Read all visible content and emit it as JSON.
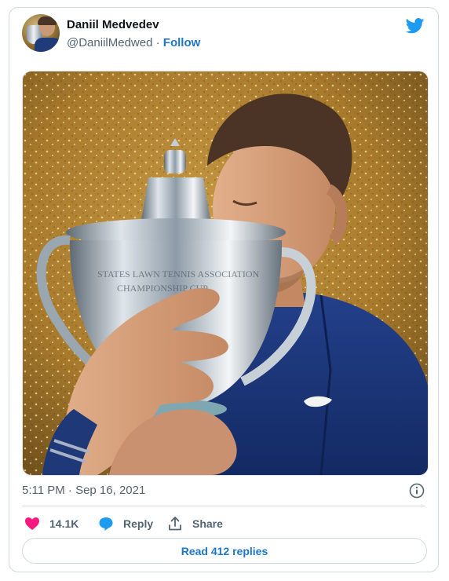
{
  "author": {
    "name": "Daniil Medvedev",
    "handle": "@DaniilMedwed",
    "separator": "·",
    "follow_label": "Follow"
  },
  "icons": {
    "brand": "twitter-bird-icon",
    "like": "heart-icon",
    "reply": "speech-bubble-icon",
    "share": "share-upload-icon",
    "info": "info-icon"
  },
  "colors": {
    "accent": "#1d9bf0",
    "link": "#1d76c9",
    "like": "#f91880",
    "muted": "#536471",
    "border": "#cfd9de"
  },
  "tweet": {
    "timestamp": "5:11 PM · Sep 16, 2021"
  },
  "actions": {
    "like_count": "14.1K",
    "reply_label": "Reply",
    "share_label": "Share"
  },
  "footer": {
    "read_replies_label": "Read 412 replies"
  }
}
